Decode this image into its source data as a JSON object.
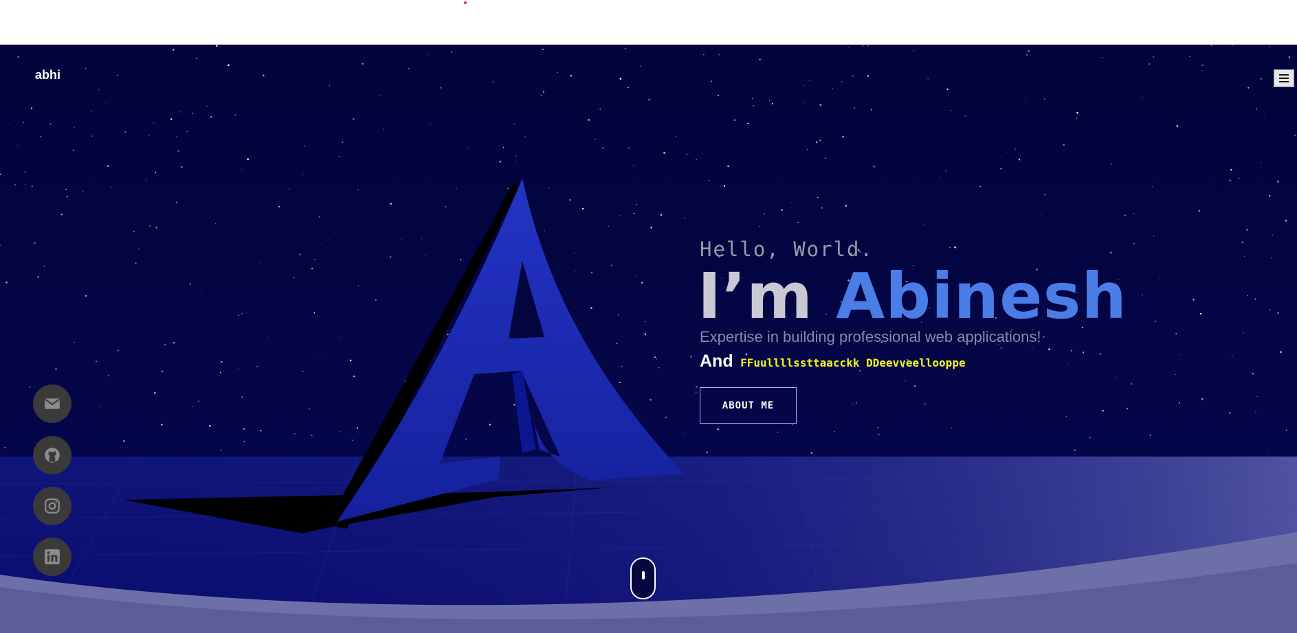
{
  "brand": {
    "logo_text": "abhi"
  },
  "nav": {
    "menu_icon": "hamburger-icon"
  },
  "hero": {
    "greeting": "Hello, World.",
    "headline_prefix": "I’m ",
    "headline_name": "Abinesh",
    "tagline": "Expertise in building professional web applications!",
    "and_label": "And",
    "role_text": "FFuullllssttaacckk DDeevveellooppe",
    "about_button_label": "ABOUT ME"
  },
  "social_links": [
    {
      "icon": "email-icon"
    },
    {
      "icon": "github-icon"
    },
    {
      "icon": "instagram-icon"
    },
    {
      "icon": "linkedin-icon"
    }
  ],
  "scroll_indicator": {
    "icon": "mouse-icon"
  },
  "colors": {
    "background": "#02043a",
    "accent_name": "#4a7de6",
    "role_text": "#f3f31e",
    "logo_blue": "#1c2cb5",
    "social_bg": "#3a3a3a",
    "wave": "#6f72a8"
  }
}
